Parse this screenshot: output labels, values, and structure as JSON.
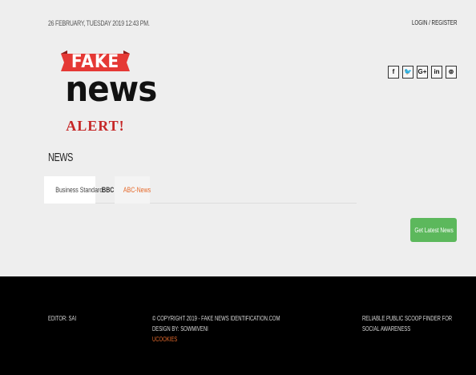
{
  "header": {
    "datetime": "26 FEBRUARY, TUESDAY 2019 12:43 PM.",
    "login_register": "LOGIN / REGISTER"
  },
  "logo": {
    "top_text": "FAKE",
    "main_text": "news",
    "bottom_text": "ALERT!",
    "colors": {
      "banner": "#e53935",
      "main": "#111111",
      "bottom": "#c62828"
    }
  },
  "social": [
    {
      "label": "f",
      "icon": "facebook-icon"
    },
    {
      "label": "🐦",
      "icon": "twitter-icon"
    },
    {
      "label": "G+",
      "icon": "google-plus-icon"
    },
    {
      "label": "in",
      "icon": "linkedin-icon"
    },
    {
      "label": "⊚",
      "icon": "pinterest-icon"
    }
  ],
  "section": {
    "title": "NEWS"
  },
  "tabs": [
    {
      "label": "Business Standard"
    },
    {
      "label": "BBC"
    },
    {
      "label": "ABC-News"
    }
  ],
  "actions": {
    "get_latest_label": "Get Latest News",
    "accent": "#5cb85c"
  },
  "footer": {
    "editor": "EDITOR: SAI",
    "copyright": "© COPYRIGHT 2019 - FAKE NEWS IDENTIFICATION.COM",
    "design": "DESIGN BY: SOWMIVENI",
    "brand": "UCOOKIES",
    "tagline_line1": "RELIABLE PUBLIC SCOOP FINDER FOR",
    "tagline_line2": "SOCIAL AWARENESS",
    "brand_color": "#e56a2c"
  }
}
